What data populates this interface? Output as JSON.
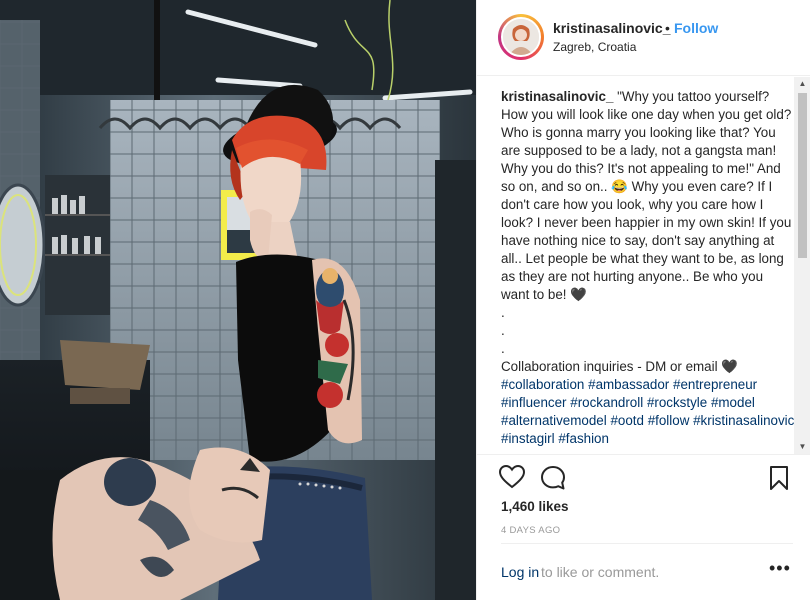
{
  "post": {
    "photo_alt_icon": "post-photo",
    "author": {
      "username": "kristinasalinovic_",
      "separator": "•",
      "follow_label": "Follow",
      "location": "Zagreb, Croatia"
    },
    "caption": {
      "username": "kristinasalinovic_",
      "text_parts": [
        {
          "type": "text",
          "value": " \"Why you tattoo yourself? How you will look like one day when you get old? Who is gonna marry you looking like that? You are supposed to be a lady, not a gangsta man! Why you do this? It's not appealing to me!\" And so on, and so on.. "
        },
        {
          "type": "emoji",
          "value": "😂"
        },
        {
          "type": "text",
          "value": " Why you even care? If I don't care how you look, why you care how I look? I never been happier in my own skin! If you have nothing nice to say, don't say anything at all.. Let people be what they want to be, as long as they are not hurting anyone.. Be who you want to be! "
        },
        {
          "type": "emoji",
          "value": "🖤"
        },
        {
          "type": "text",
          "value": "\n.\n.\n.\nCollaboration inquiries - DM or email "
        },
        {
          "type": "emoji",
          "value": "🖤"
        },
        {
          "type": "text",
          "value": "\n"
        },
        {
          "type": "tag",
          "value": "#collaboration"
        },
        {
          "type": "text",
          "value": " "
        },
        {
          "type": "tag",
          "value": "#ambassador"
        },
        {
          "type": "text",
          "value": " "
        },
        {
          "type": "tag",
          "value": "#entrepreneur"
        },
        {
          "type": "text",
          "value": " "
        },
        {
          "type": "tag",
          "value": "#influencer"
        },
        {
          "type": "text",
          "value": " "
        },
        {
          "type": "tag",
          "value": "#rockandroll"
        },
        {
          "type": "text",
          "value": " "
        },
        {
          "type": "tag",
          "value": "#rockstyle"
        },
        {
          "type": "text",
          "value": " "
        },
        {
          "type": "tag",
          "value": "#model"
        },
        {
          "type": "text",
          "value": " "
        },
        {
          "type": "tag",
          "value": "#alternativemodel"
        },
        {
          "type": "text",
          "value": " "
        },
        {
          "type": "tag",
          "value": "#ootd"
        },
        {
          "type": "text",
          "value": " "
        },
        {
          "type": "tag",
          "value": "#follow"
        },
        {
          "type": "text",
          "value": " "
        },
        {
          "type": "tag",
          "value": "#kristinasalinovic"
        },
        {
          "type": "text",
          "value": " "
        },
        {
          "type": "tag",
          "value": "#instagirl"
        },
        {
          "type": "text",
          "value": " "
        },
        {
          "type": "tag",
          "value": "#fashion"
        }
      ]
    },
    "likes": "1,460 likes",
    "time_ago": "4 DAYS AGO",
    "comment_bar": {
      "login_label": "Log in",
      "rest_label": " to like or comment.",
      "more_label": "•••"
    },
    "icons": {
      "like": "heart-outline-icon",
      "comment": "comment-bubble-icon",
      "save": "bookmark-icon",
      "more": "more-options-icon"
    }
  },
  "colors": {
    "link_blue": "#3897f0",
    "hashtag": "#003569",
    "muted": "#999999",
    "text": "#262626",
    "border": "#efefef"
  }
}
